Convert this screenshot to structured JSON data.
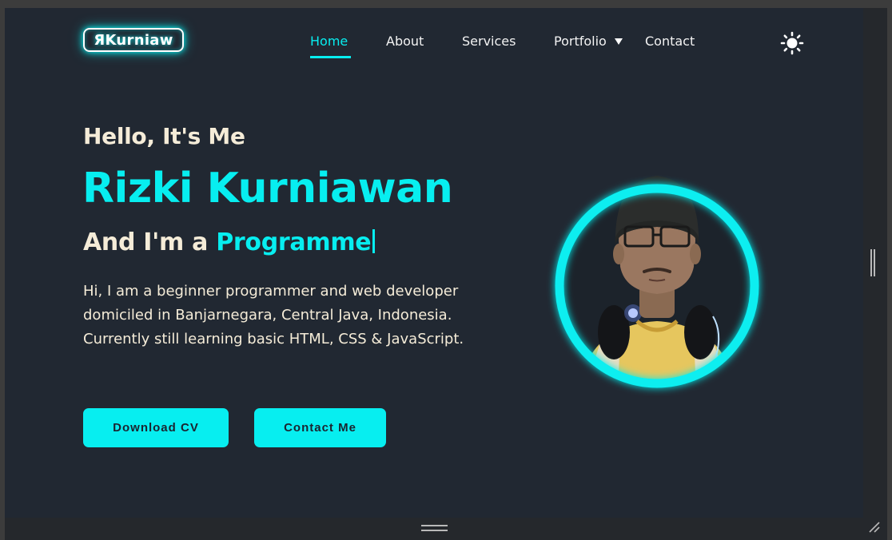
{
  "header": {
    "logo": "ЯKurniaw",
    "nav": {
      "home": "Home",
      "about": "About",
      "services": "Services",
      "portfolio": "Portfolio",
      "contact": "Contact"
    },
    "theme_icon": "sun-icon"
  },
  "hero": {
    "greeting": "Hello, It's Me",
    "name": "Rizki Kurniawan",
    "role_prefix": "And I'm a",
    "role_typed": "Programme",
    "description_lines": [
      "Hi, I am a beginner programmer and web developer",
      "domiciled in Banjarnegara, Central Java, Indonesia.",
      "Currently still learning basic HTML, CSS & JavaScript."
    ],
    "buttons": {
      "download_cv": "Download CV",
      "contact_me": "Contact Me"
    },
    "avatar": "profile-photo"
  },
  "colors": {
    "accent": "#07eef0",
    "background": "#212832",
    "text": "#f5ecd8"
  }
}
